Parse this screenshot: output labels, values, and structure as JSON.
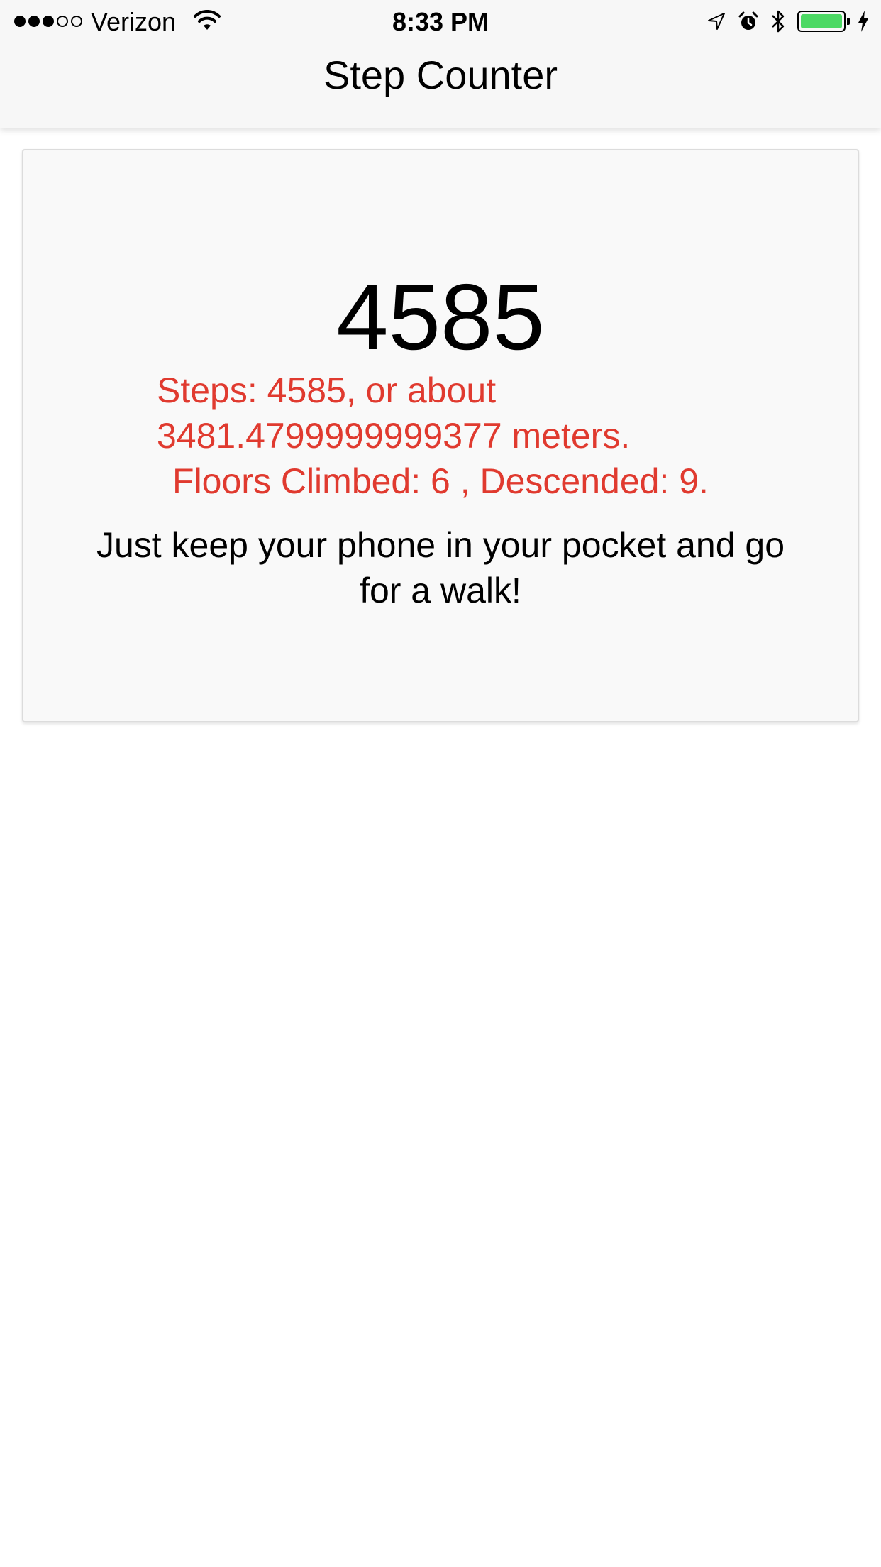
{
  "status_bar": {
    "signal_filled": 3,
    "signal_total": 5,
    "carrier": "Verizon",
    "time": "8:33 PM",
    "battery_color": "#4cd964",
    "icons": [
      "wifi-icon",
      "location-arrow-icon",
      "alarm-icon",
      "bluetooth-icon",
      "battery-icon",
      "charging-bolt-icon"
    ]
  },
  "nav": {
    "title": "Step Counter"
  },
  "card": {
    "step_count": "4585",
    "steps_text": "Steps: 4585, or about 3481.4799999999377 meters.",
    "floors_text": "Floors Climbed: 6 , Descended: 9.",
    "hint_text": "Just keep your phone in your pocket and go for a walk!",
    "accent_color": "#e03a2f"
  }
}
